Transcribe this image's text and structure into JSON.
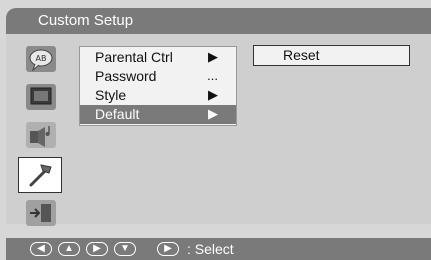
{
  "title": "Custom Setup",
  "menu": {
    "items": [
      {
        "label": "Parental Ctrl",
        "indicator": "▶"
      },
      {
        "label": "Password",
        "indicator": "..."
      },
      {
        "label": "Style",
        "indicator": "▶"
      },
      {
        "label": "Default",
        "indicator": "▶"
      }
    ],
    "highlighted_index": 3
  },
  "submenu": {
    "label": "Reset"
  },
  "side_icons": [
    "speech-bubble-icon",
    "tv-icon",
    "speaker-music-icon",
    "hammer-icon",
    "exit-icon"
  ],
  "selected_icon_index": 3,
  "help": {
    "buttons": [
      "◀",
      "▲",
      "▶",
      "▼",
      "▶"
    ],
    "text": ": Select"
  },
  "colors": {
    "title_bar": "#7a7a7a",
    "highlight": "#7a7a7a",
    "background": "#d7d7d7"
  }
}
